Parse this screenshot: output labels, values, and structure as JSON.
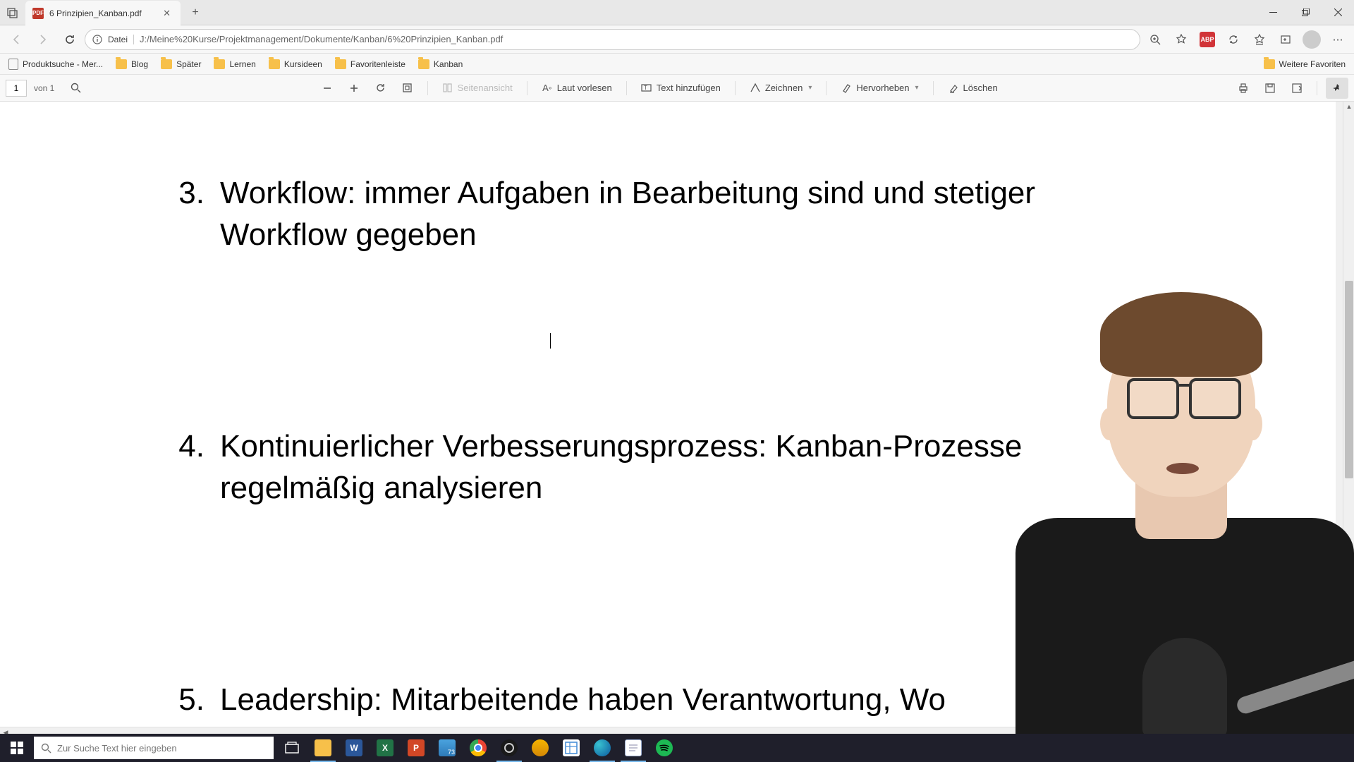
{
  "window": {
    "minimize_tooltip": "Minimieren",
    "maximize_tooltip": "Verkleinern",
    "close_tooltip": "Schließen"
  },
  "tab": {
    "title": "6 Prinzipien_Kanban.pdf",
    "favicon_label": "PDF"
  },
  "address": {
    "scheme_label": "Datei",
    "url": "J:/Meine%20Kurse/Projektmanagement/Dokumente/Kanban/6%20Prinzipien_Kanban.pdf"
  },
  "extension": {
    "abp_label": "ABP"
  },
  "bookmarks": {
    "items": [
      {
        "label": "Produktsuche - Mer...",
        "type": "page"
      },
      {
        "label": "Blog",
        "type": "folder"
      },
      {
        "label": "Später",
        "type": "folder"
      },
      {
        "label": "Lernen",
        "type": "folder"
      },
      {
        "label": "Kursideen",
        "type": "folder"
      },
      {
        "label": "Favoritenleiste",
        "type": "folder"
      },
      {
        "label": "Kanban",
        "type": "folder"
      }
    ],
    "overflow_label": "Weitere Favoriten"
  },
  "pdf_toolbar": {
    "page_current": "1",
    "page_total": "von 1",
    "page_view_label": "Seitenansicht",
    "read_aloud_label": "Laut vorlesen",
    "add_text_label": "Text hinzufügen",
    "draw_label": "Zeichnen",
    "highlight_label": "Hervorheben",
    "erase_label": "Löschen"
  },
  "pdf_content": {
    "items": [
      {
        "num": "3.",
        "text": "Workflow: immer Aufgaben in Bearbeitung sind und stetiger Workflow gegeben"
      },
      {
        "num": "4.",
        "text": "Kontinuierlicher Verbesserungsprozess: Kanban-Prozesse regelmäßig analysieren"
      },
      {
        "num": "5.",
        "text": "Leadership: Mitarbeitende haben Verantwortung, Wo"
      }
    ]
  },
  "taskbar": {
    "search_placeholder": "Zur Suche Text hier eingeben",
    "weather_badge": "73"
  }
}
